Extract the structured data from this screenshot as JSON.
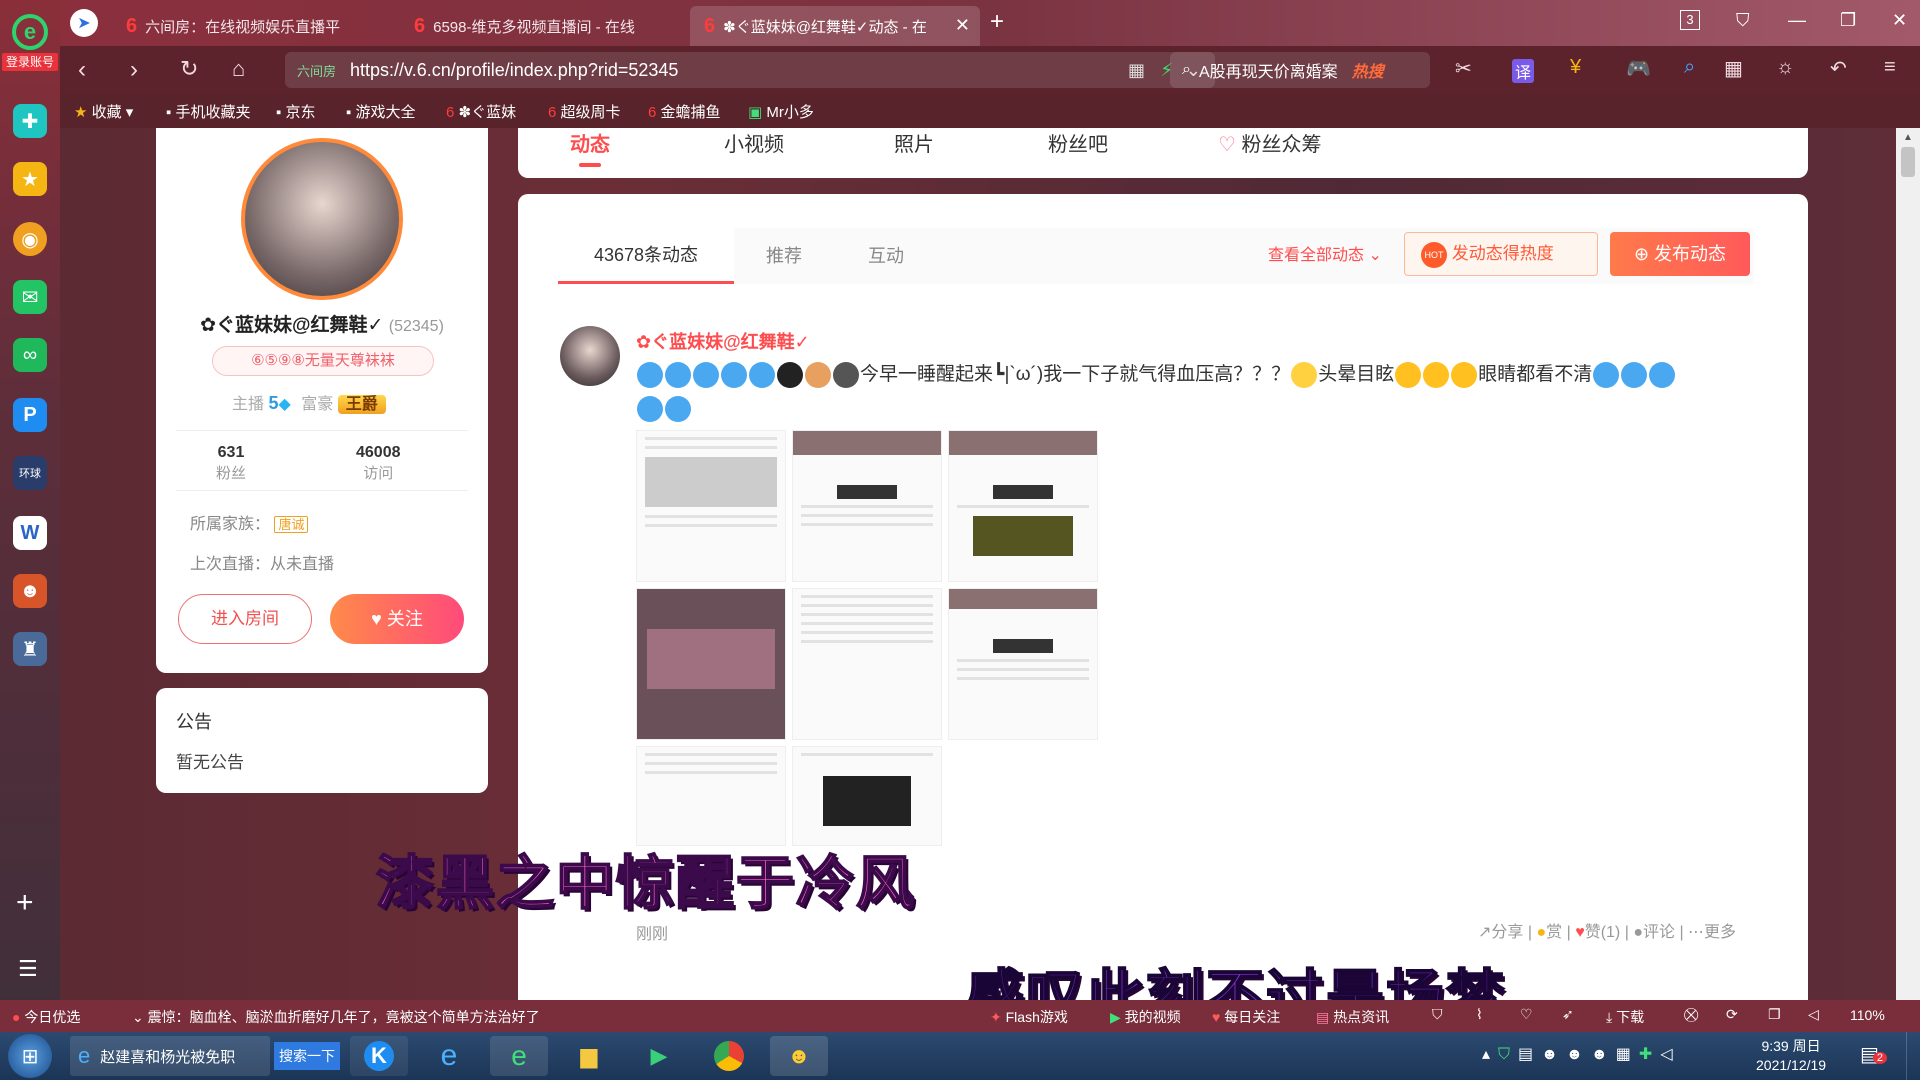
{
  "rail": {
    "login": "登录账号"
  },
  "tabs": [
    {
      "label": "六间房：在线视频娱乐直播平"
    },
    {
      "label": "6598-维克多视频直播间 - 在线"
    },
    {
      "label": "✽ぐ蓝妹妹@红舞鞋✓动态 - 在"
    }
  ],
  "window": {
    "tab_count": "3"
  },
  "address": {
    "site": "六间房",
    "url": "https://v.6.cn/profile/index.php?rid=52345"
  },
  "search": {
    "text": "A股再现天价离婚案",
    "hot": "热搜"
  },
  "bookmarks": [
    "收藏",
    "手机收藏夹",
    "京东",
    "游戏大全",
    "ぐ蓝妹",
    "超级周卡",
    "金蟾捕鱼",
    "Mr小多"
  ],
  "profile": {
    "name": "✿ぐ蓝妹妹@红舞鞋✓",
    "rid": "(52345)",
    "badge": "⑥⑤⑨⑧无量天尊袜袜",
    "anchor_label": "主播",
    "anchor_level": "5",
    "rich_label": "富豪",
    "rich_title": "王爵",
    "fans_count": "631",
    "fans_label": "粉丝",
    "visits_count": "46008",
    "visits_label": "访问",
    "family_label": "所属家族：",
    "family_value": "唐诚",
    "last_live": "上次直播：从未直播",
    "enter_room": "进入房间",
    "follow": "关注"
  },
  "notice": {
    "title": "公告",
    "content": "暂无公告"
  },
  "top_tabs": [
    "动态",
    "小视频",
    "照片",
    "粉丝吧",
    "粉丝众筹"
  ],
  "feed_tabs": [
    "43678条动态",
    "推荐",
    "互动"
  ],
  "feed_actions": {
    "view_all": "查看全部动态",
    "heat": "发动态得热度",
    "post": "发布动态"
  },
  "post": {
    "author": "✿ぐ蓝妹妹@红舞鞋✓",
    "text": "今早一睡醒起来┗|`ω´)我一下子就气得血压高？？？",
    "text2": "头晕目眩",
    "text3": "眼睛都看不清",
    "time": "刚刚",
    "share": "分享",
    "reward": "赏",
    "like": "赞(1)",
    "comment": "评论",
    "more": "更多"
  },
  "subtitles": {
    "line1": "漆黑之中惊醒于冷风",
    "line2": "感叹此刻不过是场梦"
  },
  "statusbar": {
    "today": "今日优选",
    "news": "震惊：脑血栓、脑淤血折磨好几年了，竟被这个简单方法治好了",
    "flash": "Flash游戏",
    "my_video": "我的视频",
    "daily": "每日关注",
    "hot": "热点资讯",
    "download": "下载",
    "zoom": "110%"
  },
  "taskbar": {
    "ie_item": "赵建喜和杨光被免职",
    "search_btn": "搜索一下",
    "time": "9:39 周日",
    "date": "2021/12/19",
    "notif": "2"
  }
}
